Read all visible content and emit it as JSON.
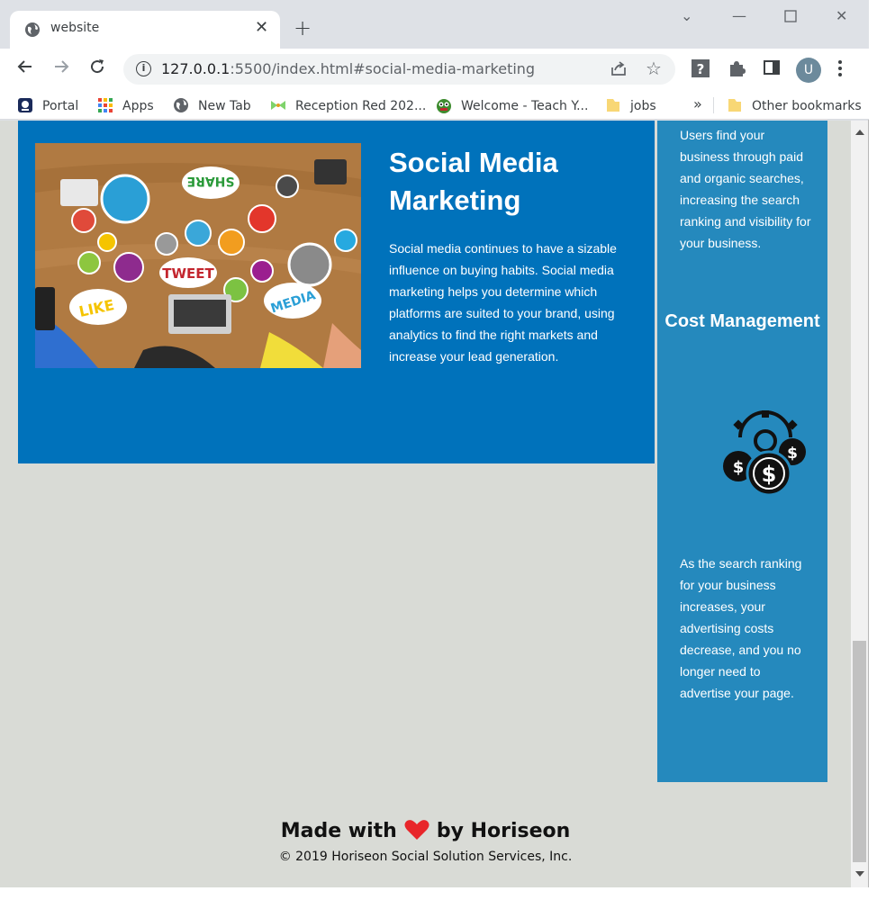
{
  "browser": {
    "tab_title": "website",
    "url_host": "127.0.0.1",
    "url_path": ":5500/index.html#social-media-marketing",
    "bookmarks": [
      "Portal",
      "Apps",
      "New Tab",
      "Reception Red 202...",
      "Welcome - Teach Y...",
      "jobs"
    ],
    "more_bookmarks": "»",
    "other_bookmarks": "Other bookmarks",
    "avatar_letter": "U"
  },
  "main": {
    "title": "Social Media Marketing",
    "body": "Social media continues to have a sizable influence on buying habits. Social media marketing helps you determine which platforms are suited to your brand, using analytics to find the right markets and increase your lead generation.",
    "image_words": [
      "SHARE",
      "TWEET",
      "LIKE",
      "MEDIA"
    ]
  },
  "sidebar": {
    "top_text": "Users find your business through paid and organic searches, increasing the search ranking and visibility for your business.",
    "cost_title": "Cost Management",
    "cost_text": "As the search ranking for your business increases, your advertising costs decrease, and you no longer need to advertise your page."
  },
  "footer": {
    "made_prefix": "Made with",
    "made_suffix": "by Horiseon",
    "copyright": "© 2019 Horiseon Social Solution Services, Inc."
  },
  "colors": {
    "primary_blue": "#0072bb",
    "side_blue": "#2589bd",
    "page_bg": "#d9dbd6",
    "heart": "#e8262a"
  }
}
